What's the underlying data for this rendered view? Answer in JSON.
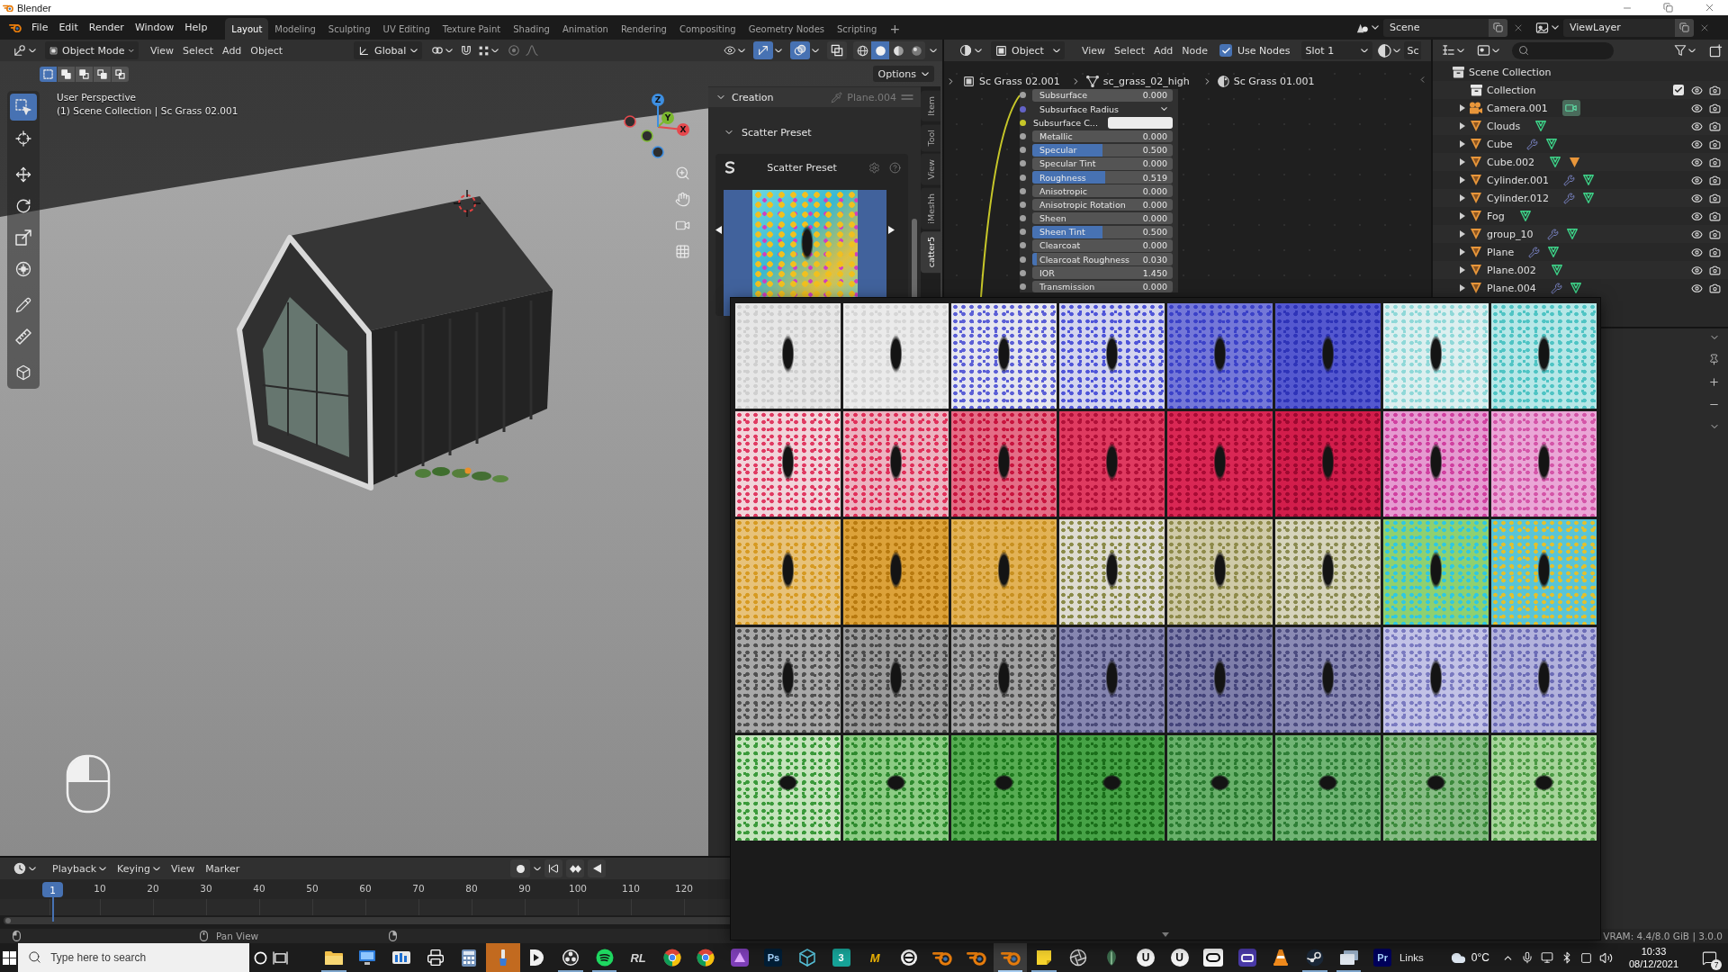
{
  "window": {
    "title": "Blender"
  },
  "top_bar": {
    "menus": [
      "File",
      "Edit",
      "Render",
      "Window",
      "Help"
    ],
    "workspaces": [
      {
        "label": "Layout",
        "selected": true
      },
      {
        "label": "Modeling",
        "selected": false
      },
      {
        "label": "Sculpting",
        "selected": false
      },
      {
        "label": "UV Editing",
        "selected": false
      },
      {
        "label": "Texture Paint",
        "selected": false
      },
      {
        "label": "Shading",
        "selected": false
      },
      {
        "label": "Animation",
        "selected": false
      },
      {
        "label": "Rendering",
        "selected": false
      },
      {
        "label": "Compositing",
        "selected": false
      },
      {
        "label": "Geometry Nodes",
        "selected": false
      },
      {
        "label": "Scripting",
        "selected": false
      }
    ],
    "add_workspace": "+",
    "scene": "Scene",
    "view_layer": "ViewLayer"
  },
  "viewport": {
    "header": {
      "mode": "Object Mode",
      "menus": [
        "View",
        "Select",
        "Add",
        "Object"
      ],
      "orientation": "Global",
      "toggles": [
        {
          "kind": "gizmo",
          "on": true
        },
        {
          "kind": "overlay",
          "on": true
        },
        {
          "kind": "xray",
          "on": false
        }
      ],
      "shading": [
        {
          "kind": "wireframe",
          "selected": false
        },
        {
          "kind": "solid",
          "selected": true
        },
        {
          "kind": "material",
          "selected": false
        },
        {
          "kind": "rendered",
          "selected": false
        }
      ]
    },
    "select_modes": [
      {
        "kind": "set",
        "selected": true
      },
      {
        "kind": "extend",
        "selected": false
      },
      {
        "kind": "subtract",
        "selected": false
      },
      {
        "kind": "invert",
        "selected": false
      },
      {
        "kind": "intersect",
        "selected": false
      }
    ],
    "info": [
      "User Perspective",
      "(1) Scene Collection | Sc Grass 02.001"
    ],
    "tools": [
      {
        "kind": "select-box",
        "selected": true
      },
      {
        "kind": "cursor",
        "selected": false
      },
      {
        "kind": "move",
        "selected": false
      },
      {
        "kind": "rotate",
        "selected": false
      },
      {
        "kind": "scale",
        "selected": false
      },
      {
        "kind": "transform",
        "selected": false
      },
      {
        "kind": "annotate",
        "selected": false
      },
      {
        "kind": "measure",
        "selected": false
      },
      {
        "kind": "add-cube",
        "selected": false
      }
    ],
    "axes": [
      {
        "label": "X",
        "color": "#e5484d"
      },
      {
        "label": "Y",
        "color": "#7bb82f"
      },
      {
        "label": "Z",
        "color": "#3d8ee0"
      }
    ],
    "options": "Options"
  },
  "sidebar": {
    "tabs": [
      {
        "label": "Item",
        "selected": false
      },
      {
        "label": "Tool",
        "selected": false
      },
      {
        "label": "View",
        "selected": false
      },
      {
        "label": "iMeshh",
        "selected": false
      },
      {
        "label": "catter5",
        "selected": true
      }
    ],
    "panel": {
      "title": "Creation",
      "expanded": true,
      "object": "Plane.004",
      "subpanel": {
        "title": "Scatter Preset",
        "expanded": true,
        "box_title": "Scatter Preset"
      }
    }
  },
  "node_editor": {
    "header": {
      "object_type": "Object",
      "menus": [
        "View",
        "Select",
        "Add",
        "Node"
      ],
      "use_nodes": {
        "label": "Use Nodes",
        "checked": true
      },
      "slot": "Slot 1",
      "material": "Sc"
    },
    "breadcrumbs": [
      {
        "kind": "object",
        "label": "Sc Grass 02.001"
      },
      {
        "kind": "mesh",
        "label": "sc_grass_02_high"
      },
      {
        "kind": "material",
        "label": "Sc Grass 01.001"
      }
    ],
    "node_inputs": [
      {
        "kind": "value",
        "label": "Subsurface",
        "value": "0.000"
      },
      {
        "kind": "vector",
        "label": "Subsurface Radius"
      },
      {
        "kind": "color",
        "label": "Subsurface C...",
        "color": "#ececec"
      },
      {
        "kind": "value",
        "label": "Metallic",
        "value": "0.000"
      },
      {
        "kind": "factor",
        "label": "Specular",
        "value": "0.500",
        "level": 0.5
      },
      {
        "kind": "value",
        "label": "Specular Tint",
        "value": "0.000"
      },
      {
        "kind": "factor",
        "label": "Roughness",
        "value": "0.519",
        "level": 0.519
      },
      {
        "kind": "value",
        "label": "Anisotropic",
        "value": "0.000"
      },
      {
        "kind": "value",
        "label": "Anisotropic Rotation",
        "value": "0.000"
      },
      {
        "kind": "value",
        "label": "Sheen",
        "value": "0.000"
      },
      {
        "kind": "factor",
        "label": "Sheen Tint",
        "value": "0.500",
        "level": 0.5
      },
      {
        "kind": "value",
        "label": "Clearcoat",
        "value": "0.000"
      },
      {
        "kind": "factor",
        "label": "Clearcoat Roughness",
        "value": "0.030",
        "level": 0.03
      },
      {
        "kind": "value",
        "label": "IOR",
        "value": "1.450"
      },
      {
        "kind": "value",
        "label": "Transmission",
        "value": "0.000"
      }
    ]
  },
  "outliner": {
    "tree": [
      {
        "name": "Scene Collection",
        "kind": "scene-collection",
        "children": [
          {
            "name": "Collection",
            "kind": "collection",
            "checked": true,
            "visible": true,
            "children": [
              {
                "name": "Camera.001",
                "kind": "camera",
                "expanded": false,
                "visible": true,
                "data_icons": [
                  {
                    "kind": "camera-data"
                  }
                ]
              },
              {
                "name": "Clouds",
                "kind": "mesh",
                "expanded": false,
                "visible": true,
                "data_icons": [
                  {
                    "kind": "mesh"
                  }
                ]
              },
              {
                "name": "Cube",
                "kind": "mesh",
                "expanded": false,
                "visible": true,
                "data_icons": [
                  {
                    "kind": "modifier"
                  },
                  {
                    "kind": "mesh"
                  }
                ]
              },
              {
                "name": "Cube.002",
                "kind": "mesh",
                "expanded": false,
                "visible": true,
                "data_icons": [
                  {
                    "kind": "mesh"
                  },
                  {
                    "kind": "object"
                  }
                ]
              },
              {
                "name": "Cylinder.001",
                "kind": "mesh",
                "expanded": false,
                "visible": true,
                "data_icons": [
                  {
                    "kind": "modifier"
                  },
                  {
                    "kind": "mesh"
                  }
                ]
              },
              {
                "name": "Cylinder.012",
                "kind": "mesh",
                "expanded": false,
                "visible": true,
                "data_icons": [
                  {
                    "kind": "modifier"
                  },
                  {
                    "kind": "mesh"
                  }
                ]
              },
              {
                "name": "Fog",
                "kind": "mesh",
                "expanded": false,
                "visible": true,
                "data_icons": [
                  {
                    "kind": "mesh"
                  }
                ]
              },
              {
                "name": "group_10",
                "kind": "mesh",
                "expanded": false,
                "visible": true,
                "data_icons": [
                  {
                    "kind": "modifier"
                  },
                  {
                    "kind": "mesh"
                  }
                ]
              },
              {
                "name": "Plane",
                "kind": "mesh",
                "expanded": false,
                "visible": true,
                "data_icons": [
                  {
                    "kind": "modifier"
                  },
                  {
                    "kind": "mesh"
                  }
                ]
              },
              {
                "name": "Plane.002",
                "kind": "mesh",
                "expanded": false,
                "visible": true,
                "data_icons": [
                  {
                    "kind": "mesh"
                  }
                ]
              },
              {
                "name": "Plane.004",
                "kind": "mesh",
                "expanded": false,
                "visible": true,
                "data_icons": [
                  {
                    "kind": "modifier"
                  },
                  {
                    "kind": "mesh"
                  }
                ]
              }
            ]
          }
        ]
      }
    ]
  },
  "timeline": {
    "menus": [
      {
        "label": "Playback",
        "dropdown": true
      },
      {
        "label": "Keying",
        "dropdown": true
      },
      {
        "label": "View",
        "dropdown": false
      },
      {
        "label": "Marker",
        "dropdown": false
      }
    ],
    "current_frame": "1",
    "ticks": [
      "10",
      "20",
      "30",
      "40",
      "50",
      "60",
      "70",
      "80",
      "90",
      "100",
      "110",
      "120"
    ]
  },
  "status_bar": {
    "hint": "Pan View",
    "stats": "VRAM: 4.4/8.0 GiB | 3.0.0"
  },
  "taskbar": {
    "search": {
      "placeholder": "Type here to search"
    },
    "apps": [
      {
        "kind": "folder",
        "running": true,
        "active": false,
        "attention": false
      },
      {
        "kind": "computer",
        "running": false,
        "active": false,
        "attention": false
      },
      {
        "kind": "bars",
        "running": false,
        "active": false,
        "attention": false
      },
      {
        "kind": "printer",
        "running": false,
        "active": false,
        "attention": false
      },
      {
        "kind": "calculator",
        "running": false,
        "active": false,
        "attention": false
      },
      {
        "kind": "brush",
        "running": false,
        "active": false,
        "attention": true
      },
      {
        "kind": "play",
        "running": false,
        "active": false,
        "attention": false
      },
      {
        "kind": "aperture",
        "running": true,
        "active": false,
        "attention": false
      },
      {
        "kind": "waves",
        "running": true,
        "active": false,
        "attention": false
      },
      {
        "kind": "letters",
        "label": "RL",
        "color": "#d4d4d4",
        "running": false,
        "active": false,
        "attention": false
      },
      {
        "kind": "wheel",
        "running": false,
        "active": false,
        "attention": false
      },
      {
        "kind": "wheel",
        "running": false,
        "active": false,
        "attention": false
      },
      {
        "kind": "triangle",
        "running": false,
        "active": false,
        "attention": false
      },
      {
        "kind": "tile",
        "label": "Ps",
        "color": "#001e36",
        "running": false,
        "active": false,
        "attention": false
      },
      {
        "kind": "cube",
        "running": false,
        "active": false,
        "attention": false
      },
      {
        "kind": "tile",
        "label": "3",
        "color": "#17a398",
        "running": false,
        "active": false,
        "attention": false
      },
      {
        "kind": "letters",
        "label": "M",
        "color": "#f2b705",
        "running": false,
        "active": false,
        "attention": false
      },
      {
        "kind": "circle",
        "running": false,
        "active": false,
        "attention": false
      },
      {
        "kind": "ring",
        "running": false,
        "active": false,
        "attention": false
      },
      {
        "kind": "ring",
        "running": false,
        "active": false,
        "attention": false
      },
      {
        "kind": "ring",
        "running": true,
        "active": true,
        "attention": false
      },
      {
        "kind": "note",
        "running": true,
        "active": false,
        "attention": false
      },
      {
        "kind": "lens",
        "running": false,
        "active": false,
        "attention": false
      },
      {
        "kind": "leaf",
        "running": false,
        "active": false,
        "attention": false
      },
      {
        "kind": "badge",
        "label": "U",
        "color": "#f2f2f2",
        "running": false,
        "active": false,
        "attention": false
      },
      {
        "kind": "badge",
        "label": "U",
        "color": "#f2f2f2",
        "running": false,
        "active": false,
        "attention": false
      },
      {
        "kind": "rounded",
        "running": false,
        "active": false,
        "attention": false
      },
      {
        "kind": "window",
        "running": false,
        "active": false,
        "attention": false
      },
      {
        "kind": "cone",
        "running": false,
        "active": false,
        "attention": false
      },
      {
        "kind": "disc",
        "running": true,
        "active": false,
        "attention": false
      },
      {
        "kind": "stack",
        "running": true,
        "active": false,
        "attention": false
      },
      {
        "kind": "tile",
        "label": "Pr",
        "color": "#00005b",
        "running": false,
        "active": false,
        "attention": false
      }
    ],
    "links": "Links",
    "weather": "0°C",
    "time": "10:33",
    "date": "08/12/2021",
    "notifications": "7"
  }
}
